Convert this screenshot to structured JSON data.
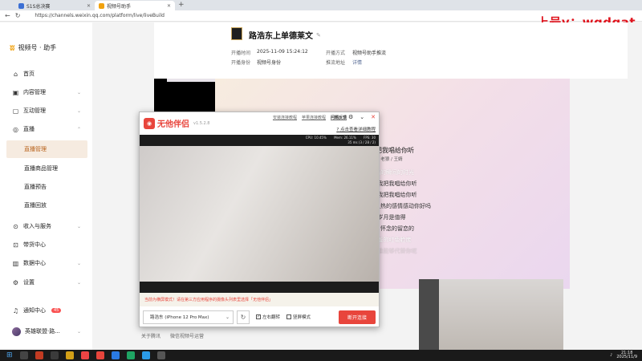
{
  "browser": {
    "tabs": [
      {
        "label": "S1S总决赛",
        "active": false
      },
      {
        "label": "视频号助手",
        "active": true
      }
    ],
    "url": "https://channels.weixin.qq.com/platform/live/liveBuild",
    "overlay_text": "上号v：wgdgat"
  },
  "sidebar": {
    "brand": "视频号 · 助手",
    "items": [
      {
        "label": "首页",
        "icon": "home-icon"
      },
      {
        "label": "内容管理",
        "icon": "content-icon"
      },
      {
        "label": "互动管理",
        "icon": "interact-icon"
      },
      {
        "label": "直播",
        "icon": "live-icon"
      },
      {
        "label": "直播管理",
        "sub": true,
        "selected": true
      },
      {
        "label": "直播商品管理",
        "sub": true
      },
      {
        "label": "直播预告",
        "sub": true
      },
      {
        "label": "直播回放",
        "sub": true
      },
      {
        "label": "收入与服务",
        "icon": "income-icon"
      },
      {
        "label": "带货中心",
        "icon": "shop-icon"
      },
      {
        "label": "数据中心",
        "icon": "data-icon"
      },
      {
        "label": "设置",
        "icon": "settings-icon"
      }
    ],
    "notification": {
      "label": "通知中心",
      "count": "45"
    },
    "user": {
      "name": "英雄联盟·路..."
    }
  },
  "live": {
    "title": "路浩东上单德莱文",
    "start_time_label": "开播时间",
    "start_time": "2025-11-09 15:24:12",
    "identity_label": "开播身份",
    "identity": "视频号身份",
    "method_label": "开播方式",
    "method": "视频号助手推流",
    "push_label": "推流地址",
    "push_link": "详情"
  },
  "lyrics": {
    "song": "想把我唱给你听",
    "artist": "老狼 / 王婧",
    "lines": [
      "幸福的瞬间的时光",
      "男：我把我唱给你听",
      "女：我把我唱给你听",
      "男：用我炙热的感情感动你好吗",
      "岁月是值得",
      "合：怀念的留恋的",
      "害羞的红色脸庞",
      "女：谁能够代替你呢"
    ]
  },
  "footer": {
    "about": "关于腾讯",
    "protocol": "微信视频号运营"
  },
  "tool": {
    "name": "无他伴侣",
    "version": "v1.5.2.8",
    "links": [
      "安装连接教程",
      "苹果连接教程",
      "问题反馈"
    ],
    "tutorial": "点击查看详细教程",
    "stats": {
      "cpu": "CPU: 10.45%",
      "mem": "Mem: 26.11%",
      "fps": "FPS: 30",
      "delay": "35 ms (3 / 28 / 2)"
    },
    "notice": "当前为横屏模式！请在第三方应用程序的摄像头列表里选择「无他伴侣」",
    "device": "路浩东 (iPhone 12 Pro Max)",
    "mirror_label": "左右翻转",
    "mirror_checked": true,
    "landscape_label": "竖屏模式",
    "landscape_checked": false,
    "disconnect": "断开连接"
  },
  "taskbar": {
    "time": "21:18",
    "date": "2025/11/9"
  },
  "colors": {
    "accent": "#e8453c",
    "brand": "#f1a20f",
    "selected_bg": "#f6ebe0",
    "selected_fg": "#b8611a"
  }
}
